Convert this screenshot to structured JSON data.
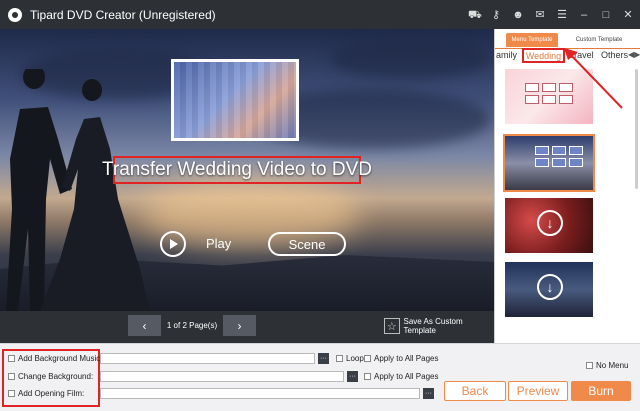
{
  "titlebar": {
    "title": "Tipard DVD Creator (Unregistered)",
    "icons": [
      "cart-icon",
      "key-icon",
      "user-icon",
      "chat-icon",
      "menu-icon",
      "minimize-icon",
      "maximize-icon",
      "close-icon"
    ]
  },
  "preview": {
    "menu_title": "Transfer Wedding Video to DVD",
    "play_label": "Play",
    "scene_label": "Scene"
  },
  "pager": {
    "prev": "‹",
    "next": "›",
    "page_info": "1 of 2 Page(s)",
    "save_template": "Save As Custom Template"
  },
  "templates": {
    "tabs": [
      "Menu Template",
      "Custom Template"
    ],
    "categories": [
      "amily",
      "Wedding",
      "Travel",
      "Others"
    ],
    "active_category": "Wedding",
    "accent": "#f08a4b"
  },
  "options": {
    "bg_music_label": "Add Background Music:",
    "bg_music_value": "",
    "change_bg_label": "Change Background:",
    "change_bg_value": "",
    "opening_film_label": "Add Opening Film:",
    "opening_film_value": "",
    "browse": "···",
    "loop": "Loop",
    "apply_all_1": "Apply to All Pages",
    "apply_all_2": "Apply to All Pages",
    "no_menu": "No Menu"
  },
  "actions": {
    "back": "Back",
    "preview": "Preview",
    "burn": "Burn"
  },
  "annotation_color": "#e02424"
}
